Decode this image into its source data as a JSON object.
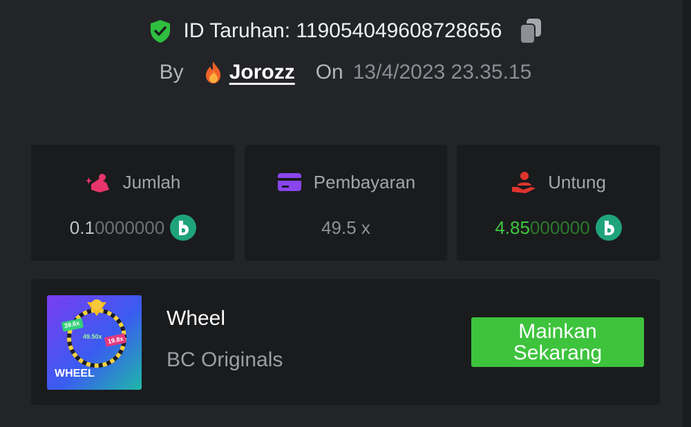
{
  "header": {
    "bet_id_label": "ID Taruhan: 119054049608728656",
    "by_label": "By",
    "username": "Jorozz",
    "on_label": "On",
    "date": "13/4/2023 23.35.15"
  },
  "cards": [
    {
      "label": "Jumlah",
      "value_main": "0.1",
      "value_trailing": "0000000",
      "icon": "coins-hand-icon"
    },
    {
      "label": "Pembayaran",
      "value_main": "49.5 x",
      "icon": "credit-card-icon"
    },
    {
      "label": "Untung",
      "value_main": "4.85",
      "value_trailing": "000000",
      "icon": "profit-hand-icon"
    }
  ],
  "game": {
    "name": "Wheel",
    "provider": "BC Originals",
    "play_label": "Mainkan Sekarang",
    "thumbnail": {
      "title": "WHEEL",
      "multipliers": [
        "39.6x",
        "49.50x",
        "19.8x"
      ]
    }
  },
  "colors": {
    "background": "#232427",
    "card": "#1a1b1d",
    "accent_green": "#3ec33d",
    "coin": "#1fa37b",
    "shield": "#2fbf3f"
  }
}
